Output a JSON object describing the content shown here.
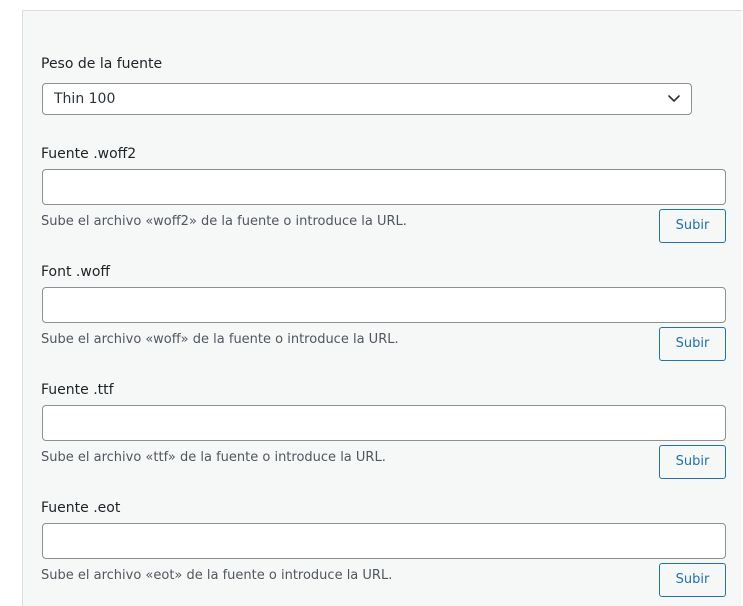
{
  "weight": {
    "label": "Peso de la fuente",
    "selected": "Thin 100"
  },
  "fields": [
    {
      "label": "Fuente .woff2",
      "value": "",
      "description": "Sube el archivo «woff2» de la fuente o introduce la URL.",
      "button_label": "Subir"
    },
    {
      "label": "Font .woff",
      "value": "",
      "description": "Sube el archivo «woff» de la fuente o introduce la URL.",
      "button_label": "Subir"
    },
    {
      "label": "Fuente .ttf",
      "value": "",
      "description": "Sube el archivo «ttf» de la fuente o introduce la URL.",
      "button_label": "Subir"
    },
    {
      "label": "Fuente .eot",
      "value": "",
      "description": "Sube el archivo «eot» de la fuente o introduce la URL.",
      "button_label": "Subir"
    }
  ],
  "colors": {
    "panel_bg": "#f6f7f7",
    "border": "#8c8f94",
    "accent": "#2271b1",
    "muted_text": "#50575e"
  },
  "icons": {
    "dropdown": "chevron-down-icon"
  }
}
